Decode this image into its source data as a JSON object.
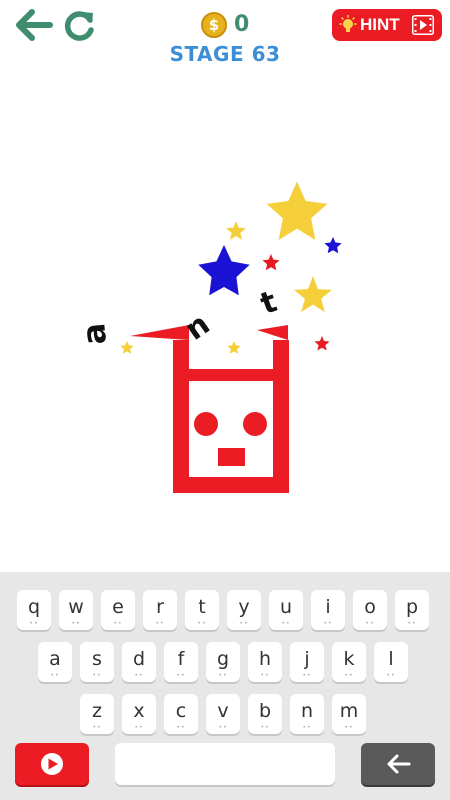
{
  "header": {
    "coin_symbol": "$",
    "coins": "0",
    "stage_label": "STAGE 63",
    "hint_label": "HINT"
  },
  "puzzle": {
    "letters": [
      "a",
      "n",
      "t"
    ],
    "colors": {
      "box": "#ec1c24",
      "yellow_star": "#f5cf3a",
      "blue_star": "#1a12d4",
      "red_star": "#e81c24"
    }
  },
  "keyboard": {
    "rows": [
      [
        "q",
        "w",
        "e",
        "r",
        "t",
        "y",
        "u",
        "i",
        "o",
        "p"
      ],
      [
        "a",
        "s",
        "d",
        "f",
        "g",
        "h",
        "j",
        "k",
        "l"
      ],
      [
        "z",
        "x",
        "c",
        "v",
        "b",
        "n",
        "m"
      ]
    ],
    "key_dots": "••",
    "answer_value": ""
  },
  "icons": {
    "back": "back-arrow-icon",
    "restart": "restart-icon",
    "coin": "coin-icon",
    "hint": "lightbulb-icon",
    "video": "video-icon",
    "play": "play-icon",
    "delete": "backspace-arrow-icon"
  }
}
